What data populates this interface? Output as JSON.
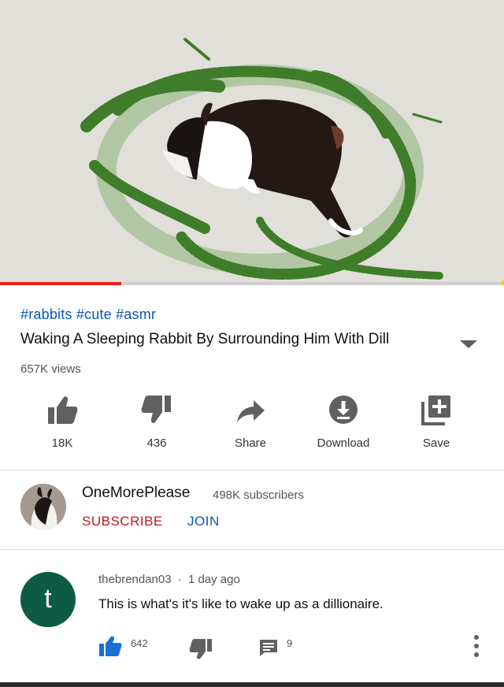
{
  "video": {
    "thumbnail": "rabbit-surrounded-by-dill",
    "progress_fraction": 0.24
  },
  "meta": {
    "hashtags": "#rabbits #cute #asmr",
    "title": "Waking A Sleeping Rabbit By Surrounding Him With Dill",
    "views": "657K views"
  },
  "actions": [
    {
      "icon": "thumb-up-icon",
      "label": "18K"
    },
    {
      "icon": "thumb-down-icon",
      "label": "436"
    },
    {
      "icon": "share-icon",
      "label": "Share"
    },
    {
      "icon": "download-icon",
      "label": "Download"
    },
    {
      "icon": "add-to-playlist-icon",
      "label": "Save"
    }
  ],
  "channel": {
    "name": "OneMorePlease",
    "subscribers": "498K subscribers",
    "subscribe_label": "SUBSCRIBE",
    "join_label": "JOIN"
  },
  "comment": {
    "avatar_letter": "t",
    "author": "thebrendan03",
    "separator": "·",
    "time": "1 day ago",
    "text": "This is what's it's like to wake up as a dillionaire.",
    "likes": "642",
    "replies": "9"
  },
  "colors": {
    "link_blue": "#0b57b8",
    "subscribe_red": "#c0161c",
    "progress_red": "#e62117",
    "avatar_green": "#0d5a45"
  }
}
